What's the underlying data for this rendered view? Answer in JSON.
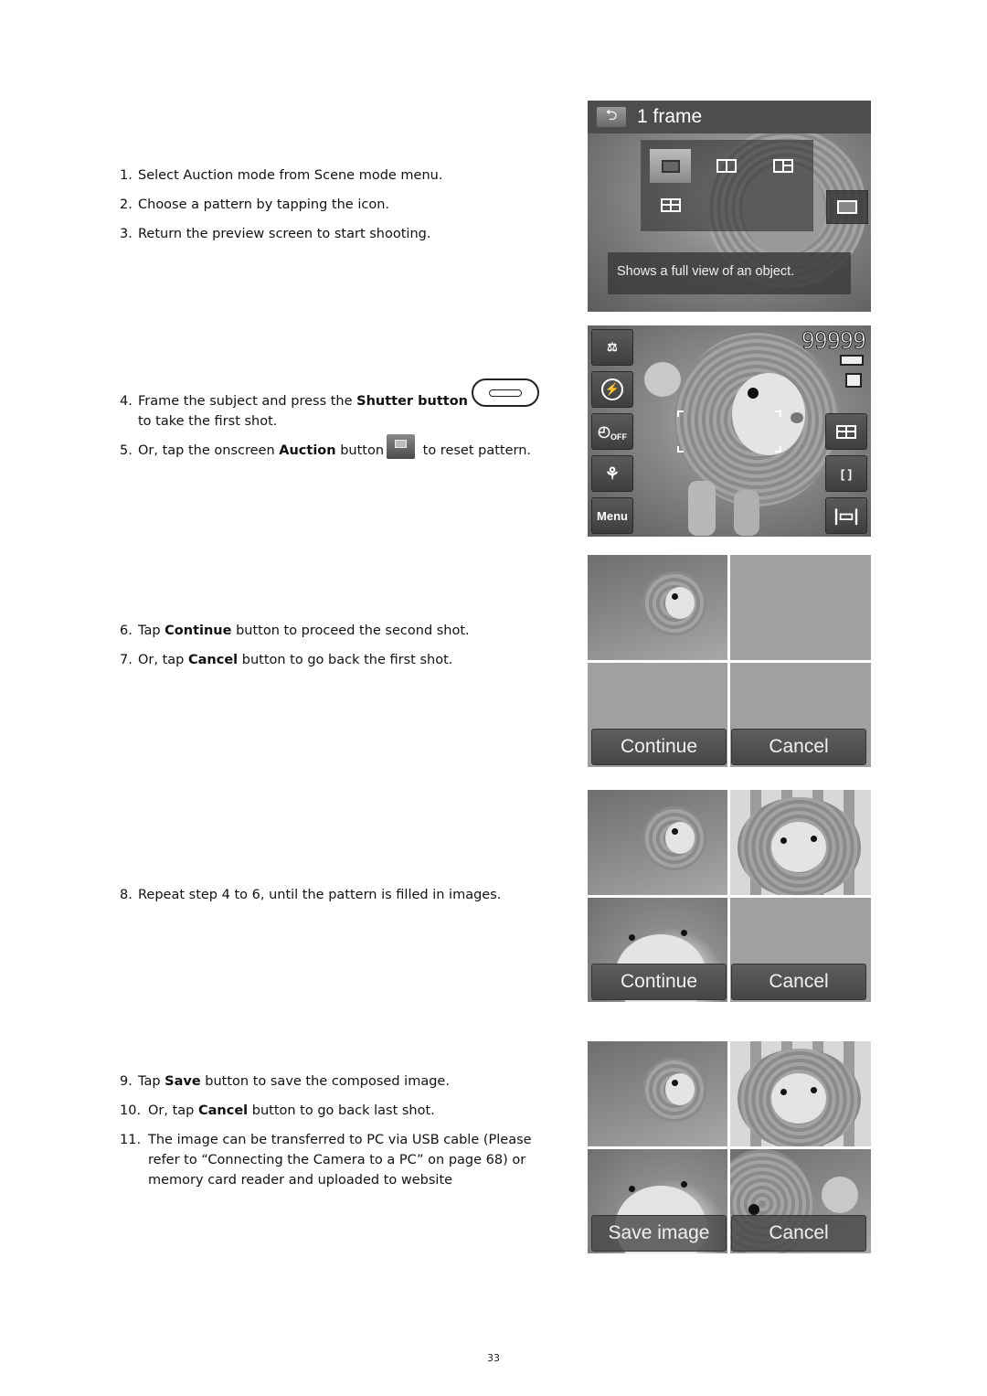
{
  "steps": [
    {
      "num": "1.",
      "parts": [
        {
          "t": "Select Auction mode from Scene mode menu.",
          "b": false
        }
      ]
    },
    {
      "num": "2.",
      "parts": [
        {
          "t": "Choose a pattern by tapping the icon.",
          "b": false
        }
      ]
    },
    {
      "num": "3.",
      "parts": [
        {
          "t": "Return the preview screen to start shooting.",
          "b": false
        }
      ]
    },
    {
      "num": "4.",
      "pre": "Frame the subject and press the ",
      "bold": "Shutter button",
      "cont": "to take the first shot."
    },
    {
      "num": "5.",
      "pre": "Or, tap the onscreen ",
      "bold": "Auction",
      "mid": " button",
      "post": " to reset pattern."
    },
    {
      "num": "6.",
      "pre": "Tap ",
      "bold": "Continue",
      "post": " button to proceed the second shot."
    },
    {
      "num": "7.",
      "pre": "Or, tap ",
      "bold": "Cancel",
      "post": " button to go back the first shot."
    },
    {
      "num": "8.",
      "text": "Repeat step 4 to 6, until the pattern is filled in images."
    },
    {
      "num": "9.",
      "pre": "Tap ",
      "bold": "Save",
      "post": " button to save the composed image."
    },
    {
      "num": "10.",
      "pre": "Or, tap ",
      "bold": "Cancel",
      "post": " button to go back last shot."
    },
    {
      "num": "11.",
      "line1": "The image can be transferred to PC via USB cable (Please",
      "line2": "refer to “Connecting the Camera to a PC” on page 68) or",
      "line3": "memory card reader and uploaded to website"
    }
  ],
  "screen1": {
    "title": "1 frame",
    "back_icon": "back-arrow-icon",
    "patterns": [
      "1-frame",
      "2-frame-vertical",
      "3-frame",
      "4-frame"
    ],
    "selected_pattern": "1-frame",
    "hint": "Shows a full view of an object."
  },
  "screen2": {
    "shot_count": "99999",
    "left_buttons": [
      "scene-mode-icon",
      "flash-off-icon",
      "self-timer-off-icon",
      "macro-icon",
      "Menu"
    ],
    "menu_label": "Menu",
    "timer_label": "OFF",
    "right_buttons": [
      "auction-pattern-icon",
      "focus-area-icon",
      "display-mode-icon"
    ]
  },
  "screen3": {
    "continue_label": "Continue",
    "cancel_label": "Cancel"
  },
  "screen4": {
    "continue_label": "Continue",
    "cancel_label": "Cancel"
  },
  "screen5": {
    "save_label": "Save image",
    "cancel_label": "Cancel"
  },
  "page_number": "33"
}
